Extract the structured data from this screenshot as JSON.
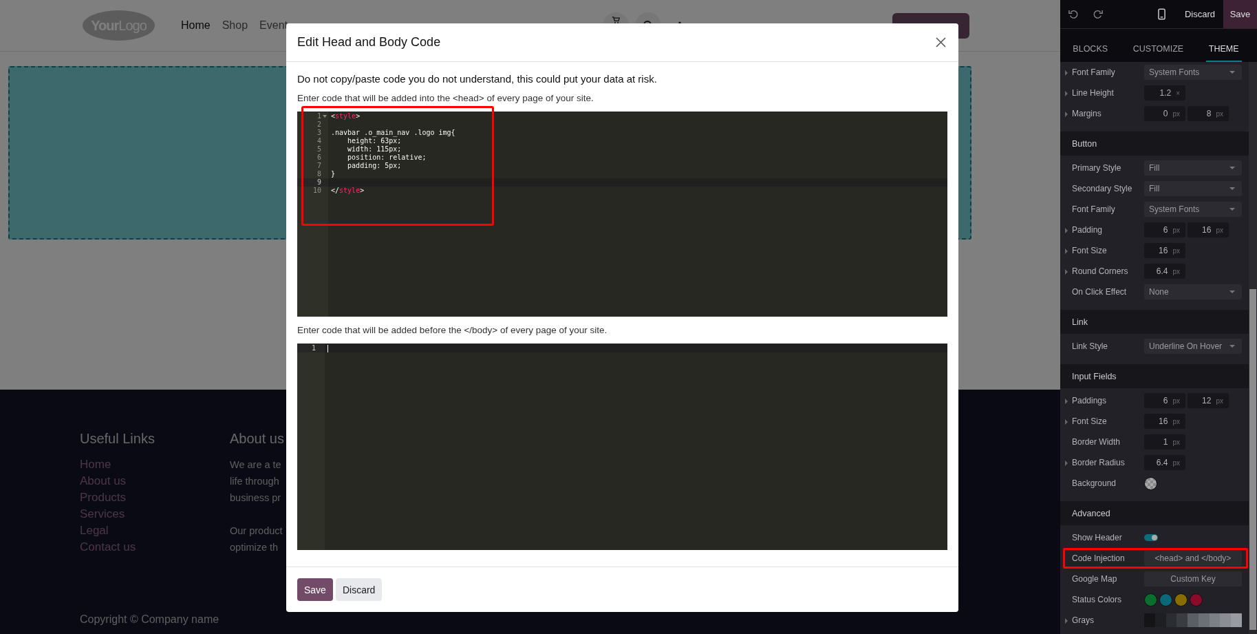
{
  "site": {
    "logo": "**Your**Logo",
    "nav": [
      {
        "label": "Home",
        "selected": true
      },
      {
        "label": "Shop",
        "selected": false
      },
      {
        "label": "Event",
        "selected": false
      }
    ],
    "footer": {
      "links_title": "Useful Links",
      "links": [
        "Home",
        "About us",
        "Products",
        "Services",
        "Legal",
        "Contact us"
      ],
      "about_title": "About us",
      "paragraphs": [
        [
          "We are a te",
          "life through",
          "business pr"
        ],
        [
          "Our product",
          "optimize th"
        ]
      ],
      "copyright": "Copyright © Company name"
    }
  },
  "dialog": {
    "title": "Edit Head and Body Code",
    "warning": "Do not copy/paste code you do not understand, this could put your data at risk.",
    "editors": [
      {
        "label": "Enter code that will be added into the <head> of every page of your site.",
        "highlighted": true,
        "lines": [
          {
            "number": "1",
            "active": false,
            "foldable": true,
            "tokens": [
              {
                "text": "<",
                "kind": "punct"
              },
              {
                "text": "style",
                "kind": "tag"
              },
              {
                "text": ">",
                "kind": "punct"
              }
            ]
          },
          {
            "number": "2",
            "active": false
          },
          {
            "number": "3",
            "active": false,
            "tokens": [
              {
                "text": ".navbar .o_main_nav .logo img{",
                "kind": "plain"
              }
            ]
          },
          {
            "number": "4",
            "active": false,
            "tokens": [
              {
                "text": "    height: 63px;",
                "kind": "plain"
              }
            ]
          },
          {
            "number": "5",
            "active": false,
            "tokens": [
              {
                "text": "    width: 115px;",
                "kind": "plain"
              }
            ]
          },
          {
            "number": "6",
            "active": false,
            "tokens": [
              {
                "text": "    position: relative;",
                "kind": "plain"
              }
            ]
          },
          {
            "number": "7",
            "active": false,
            "tokens": [
              {
                "text": "    padding: 5px;",
                "kind": "plain"
              }
            ]
          },
          {
            "number": "8",
            "active": false,
            "tokens": [
              {
                "text": "}",
                "kind": "plain"
              }
            ]
          },
          {
            "number": "9",
            "active": true
          },
          {
            "number": "10",
            "active": false,
            "tokens": [
              {
                "text": "</",
                "kind": "punct"
              },
              {
                "text": "style",
                "kind": "tag"
              },
              {
                "text": ">",
                "kind": "punct"
              }
            ]
          }
        ]
      },
      {
        "label": "Enter code that will be added before the </body> of every page of your site.",
        "highlighted": false,
        "lines": [
          {
            "number": "1",
            "active": true,
            "cursor": true
          }
        ]
      }
    ],
    "buttons": [
      {
        "label": "Save",
        "kind": "primary"
      },
      {
        "label": "Discard",
        "kind": "secondary"
      }
    ]
  },
  "panel": {
    "toolbar": {
      "discard": "Discard",
      "save": "Save"
    },
    "tabs": [
      {
        "label": "BLOCKS",
        "selected": false
      },
      {
        "label": "CUSTOMIZE",
        "selected": false
      },
      {
        "label": "THEME",
        "selected": true
      }
    ],
    "sections": [
      {
        "rows": [
          {
            "label": "Font Family",
            "expandable": true,
            "kind": "select",
            "value": "System Fonts"
          },
          {
            "label": "Line Height",
            "expandable": true,
            "kind": "number",
            "inputs": [
              {
                "value": "1.2",
                "unit": "×"
              }
            ]
          },
          {
            "label": "Margins",
            "expandable": true,
            "kind": "number",
            "inputs": [
              {
                "value": "0",
                "unit": "px"
              },
              {
                "value": "8",
                "unit": "px"
              }
            ]
          }
        ]
      },
      {
        "title": "Button",
        "rows": [
          {
            "label": "Primary Style",
            "expandable": false,
            "kind": "select",
            "value": "Fill"
          },
          {
            "label": "Secondary Style",
            "expandable": false,
            "kind": "select",
            "value": "Fill"
          },
          {
            "label": "Font Family",
            "expandable": false,
            "kind": "select",
            "value": "System Fonts"
          },
          {
            "label": "Padding",
            "expandable": true,
            "kind": "number",
            "inputs": [
              {
                "value": "6",
                "unit": "px"
              },
              {
                "value": "16",
                "unit": "px"
              }
            ]
          },
          {
            "label": "Font Size",
            "expandable": true,
            "kind": "number",
            "inputs": [
              {
                "value": "16",
                "unit": "px"
              }
            ]
          },
          {
            "label": "Round Corners",
            "expandable": true,
            "kind": "number",
            "inputs": [
              {
                "value": "6.4",
                "unit": "px"
              }
            ]
          },
          {
            "label": "On Click Effect",
            "expandable": false,
            "kind": "select",
            "value": "None"
          }
        ]
      },
      {
        "title": "Link",
        "rows": [
          {
            "label": "Link Style",
            "expandable": false,
            "kind": "select",
            "value": "Underline On Hover"
          }
        ]
      },
      {
        "title": "Input Fields",
        "rows": [
          {
            "label": "Paddings",
            "expandable": true,
            "kind": "number",
            "inputs": [
              {
                "value": "6",
                "unit": "px"
              },
              {
                "value": "12",
                "unit": "px"
              }
            ]
          },
          {
            "label": "Font Size",
            "expandable": true,
            "kind": "number",
            "inputs": [
              {
                "value": "16",
                "unit": "px"
              }
            ]
          },
          {
            "label": "Border Width",
            "expandable": false,
            "kind": "number",
            "inputs": [
              {
                "value": "1",
                "unit": "px"
              }
            ]
          },
          {
            "label": "Border Radius",
            "expandable": true,
            "kind": "number",
            "inputs": [
              {
                "value": "6.4",
                "unit": "px"
              }
            ]
          },
          {
            "label": "Background",
            "expandable": false,
            "kind": "swatch"
          }
        ]
      },
      {
        "title": "Advanced",
        "rows": [
          {
            "label": "Show Header",
            "expandable": false,
            "kind": "toggle",
            "on": true
          },
          {
            "label": "Code Injection",
            "expandable": false,
            "kind": "button",
            "value": "<head> and </body>",
            "highlighted": true
          },
          {
            "label": "Google Map",
            "expandable": false,
            "kind": "button",
            "value": "Custom Key"
          },
          {
            "label": "Status Colors",
            "expandable": false,
            "kind": "colors",
            "colors": [
              {
                "color": "#0b6e2f"
              },
              {
                "color": "#0a6878"
              },
              {
                "color": "#8a6d00"
              },
              {
                "color": "#8a0a2a"
              }
            ]
          },
          {
            "label": "Grays",
            "expandable": true,
            "kind": "grays",
            "colors": [
              {
                "color": "#141417"
              },
              {
                "color": "#1d1f23"
              },
              {
                "color": "#2a2d32"
              },
              {
                "color": "#393d42"
              },
              {
                "color": "#5a5e65"
              },
              {
                "color": "#6b6f76"
              },
              {
                "color": "#7b7f86"
              },
              {
                "color": "#8a8e94"
              },
              {
                "color": "#989ba1"
              }
            ]
          }
        ]
      }
    ]
  }
}
